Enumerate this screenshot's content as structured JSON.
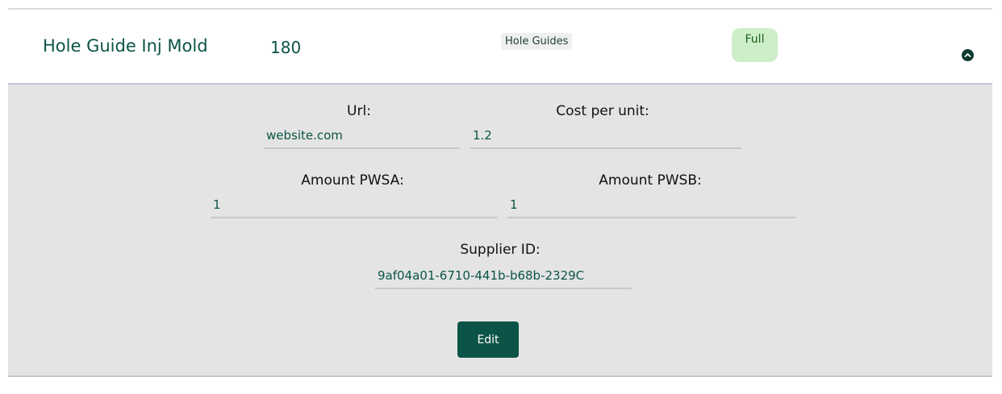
{
  "item": {
    "name": "Hole Guide Inj Mold",
    "quantity": "180",
    "category": "Hole Guides",
    "status": "Full"
  },
  "details": {
    "url_label": "Url:",
    "url_value": "website.com",
    "cost_label": "Cost per unit:",
    "cost_value": "1.2",
    "pwsa_label": "Amount PWSA:",
    "pwsa_value": "1",
    "pwsb_label": "Amount PWSB:",
    "pwsb_value": "1",
    "supplier_label": "Supplier ID:",
    "supplier_value": "9af04a01-6710-441b-b68b-2329C",
    "edit_label": "Edit"
  },
  "icons": {
    "toggle": "chevron-up-circle-icon"
  },
  "colors": {
    "accent": "#0c5447",
    "status_bg": "#cdeec8",
    "panel_bg": "#e4e4e4"
  }
}
